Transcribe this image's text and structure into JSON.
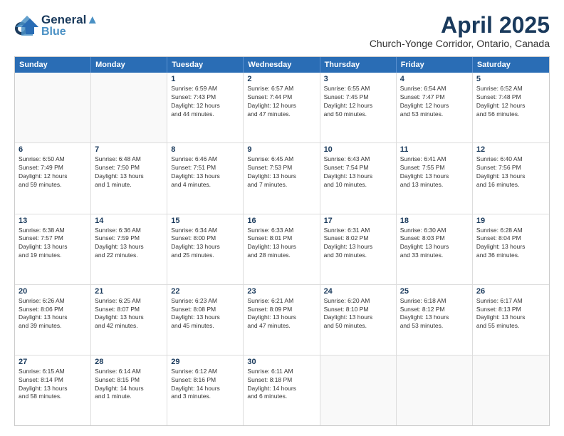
{
  "header": {
    "logo_line1": "General",
    "logo_line2": "Blue",
    "month": "April 2025",
    "location": "Church-Yonge Corridor, Ontario, Canada"
  },
  "days_of_week": [
    "Sunday",
    "Monday",
    "Tuesday",
    "Wednesday",
    "Thursday",
    "Friday",
    "Saturday"
  ],
  "weeks": [
    [
      {
        "day": "",
        "info": ""
      },
      {
        "day": "",
        "info": ""
      },
      {
        "day": "1",
        "info": "Sunrise: 6:59 AM\nSunset: 7:43 PM\nDaylight: 12 hours\nand 44 minutes."
      },
      {
        "day": "2",
        "info": "Sunrise: 6:57 AM\nSunset: 7:44 PM\nDaylight: 12 hours\nand 47 minutes."
      },
      {
        "day": "3",
        "info": "Sunrise: 6:55 AM\nSunset: 7:45 PM\nDaylight: 12 hours\nand 50 minutes."
      },
      {
        "day": "4",
        "info": "Sunrise: 6:54 AM\nSunset: 7:47 PM\nDaylight: 12 hours\nand 53 minutes."
      },
      {
        "day": "5",
        "info": "Sunrise: 6:52 AM\nSunset: 7:48 PM\nDaylight: 12 hours\nand 56 minutes."
      }
    ],
    [
      {
        "day": "6",
        "info": "Sunrise: 6:50 AM\nSunset: 7:49 PM\nDaylight: 12 hours\nand 59 minutes."
      },
      {
        "day": "7",
        "info": "Sunrise: 6:48 AM\nSunset: 7:50 PM\nDaylight: 13 hours\nand 1 minute."
      },
      {
        "day": "8",
        "info": "Sunrise: 6:46 AM\nSunset: 7:51 PM\nDaylight: 13 hours\nand 4 minutes."
      },
      {
        "day": "9",
        "info": "Sunrise: 6:45 AM\nSunset: 7:53 PM\nDaylight: 13 hours\nand 7 minutes."
      },
      {
        "day": "10",
        "info": "Sunrise: 6:43 AM\nSunset: 7:54 PM\nDaylight: 13 hours\nand 10 minutes."
      },
      {
        "day": "11",
        "info": "Sunrise: 6:41 AM\nSunset: 7:55 PM\nDaylight: 13 hours\nand 13 minutes."
      },
      {
        "day": "12",
        "info": "Sunrise: 6:40 AM\nSunset: 7:56 PM\nDaylight: 13 hours\nand 16 minutes."
      }
    ],
    [
      {
        "day": "13",
        "info": "Sunrise: 6:38 AM\nSunset: 7:57 PM\nDaylight: 13 hours\nand 19 minutes."
      },
      {
        "day": "14",
        "info": "Sunrise: 6:36 AM\nSunset: 7:59 PM\nDaylight: 13 hours\nand 22 minutes."
      },
      {
        "day": "15",
        "info": "Sunrise: 6:34 AM\nSunset: 8:00 PM\nDaylight: 13 hours\nand 25 minutes."
      },
      {
        "day": "16",
        "info": "Sunrise: 6:33 AM\nSunset: 8:01 PM\nDaylight: 13 hours\nand 28 minutes."
      },
      {
        "day": "17",
        "info": "Sunrise: 6:31 AM\nSunset: 8:02 PM\nDaylight: 13 hours\nand 30 minutes."
      },
      {
        "day": "18",
        "info": "Sunrise: 6:30 AM\nSunset: 8:03 PM\nDaylight: 13 hours\nand 33 minutes."
      },
      {
        "day": "19",
        "info": "Sunrise: 6:28 AM\nSunset: 8:04 PM\nDaylight: 13 hours\nand 36 minutes."
      }
    ],
    [
      {
        "day": "20",
        "info": "Sunrise: 6:26 AM\nSunset: 8:06 PM\nDaylight: 13 hours\nand 39 minutes."
      },
      {
        "day": "21",
        "info": "Sunrise: 6:25 AM\nSunset: 8:07 PM\nDaylight: 13 hours\nand 42 minutes."
      },
      {
        "day": "22",
        "info": "Sunrise: 6:23 AM\nSunset: 8:08 PM\nDaylight: 13 hours\nand 45 minutes."
      },
      {
        "day": "23",
        "info": "Sunrise: 6:21 AM\nSunset: 8:09 PM\nDaylight: 13 hours\nand 47 minutes."
      },
      {
        "day": "24",
        "info": "Sunrise: 6:20 AM\nSunset: 8:10 PM\nDaylight: 13 hours\nand 50 minutes."
      },
      {
        "day": "25",
        "info": "Sunrise: 6:18 AM\nSunset: 8:12 PM\nDaylight: 13 hours\nand 53 minutes."
      },
      {
        "day": "26",
        "info": "Sunrise: 6:17 AM\nSunset: 8:13 PM\nDaylight: 13 hours\nand 55 minutes."
      }
    ],
    [
      {
        "day": "27",
        "info": "Sunrise: 6:15 AM\nSunset: 8:14 PM\nDaylight: 13 hours\nand 58 minutes."
      },
      {
        "day": "28",
        "info": "Sunrise: 6:14 AM\nSunset: 8:15 PM\nDaylight: 14 hours\nand 1 minute."
      },
      {
        "day": "29",
        "info": "Sunrise: 6:12 AM\nSunset: 8:16 PM\nDaylight: 14 hours\nand 3 minutes."
      },
      {
        "day": "30",
        "info": "Sunrise: 6:11 AM\nSunset: 8:18 PM\nDaylight: 14 hours\nand 6 minutes."
      },
      {
        "day": "",
        "info": ""
      },
      {
        "day": "",
        "info": ""
      },
      {
        "day": "",
        "info": ""
      }
    ]
  ]
}
